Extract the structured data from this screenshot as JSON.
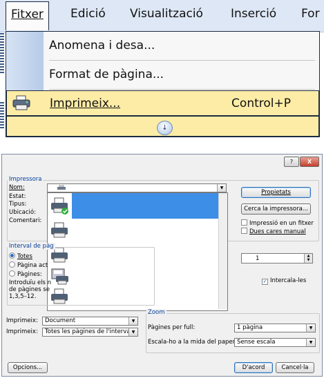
{
  "menu": {
    "bar": [
      "Fitxer",
      "Edició",
      "Visualització",
      "Inserció",
      "For"
    ],
    "items": [
      {
        "label": "Anomena i desa..."
      },
      {
        "label": "Format de pàgina..."
      },
      {
        "label": "Imprimeix...",
        "shortcut": "Control+P"
      }
    ]
  },
  "dialog": {
    "help": "?",
    "close": "X",
    "printer_group": "Impressora",
    "name_label": "Nom:",
    "status_label": "Estat:",
    "type_label": "Tipus:",
    "location_label": "Ubicació:",
    "comment_label": "Comentari:",
    "properties_btn": "Propietats",
    "find_printer_btn": "Cerca la impressora...",
    "print_to_file": "Impressió en un fitxer",
    "manual_duplex": "Dues cares manual",
    "range_group": "Interval de pàg",
    "range_all": "Totes",
    "range_current": "Pàgina act",
    "range_pages": "Pàgines:",
    "range_hint_1": "Introduïu els n",
    "range_hint_2": "de pàgines se",
    "range_hint_3": "1,3,5–12.",
    "copies_value": "1",
    "collate_label": "Intercala-les",
    "print_what_label": "Imprimeix:",
    "print_what_value": "Document",
    "print_label": "Imprimeix:",
    "print_value": "Totes les pàgines de l'interval",
    "zoom_group": "Zoom",
    "pages_per_sheet_label": "Pàgines per full:",
    "pages_per_sheet_value": "1 pàgina",
    "scale_label": "Escala-ho a la mida del paper:",
    "scale_value": "Sense escala",
    "options_btn": "Opcions...",
    "ok_btn": "D'acord",
    "cancel_btn": "Cancel·la"
  }
}
